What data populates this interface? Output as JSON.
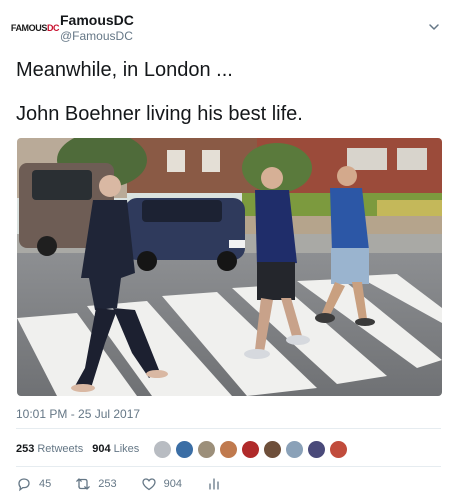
{
  "account": {
    "display_name": "FamousDC",
    "handle": "@FamousDC",
    "logo_text_left": "FAMOUS",
    "logo_text_right": "DC"
  },
  "tweet": {
    "line1": "Meanwhile, in London ...",
    "line2": "John Boehner living his best life."
  },
  "media": {
    "icon": "photo"
  },
  "timestamp": "10:01 PM - 25 Jul 2017",
  "stats": {
    "retweets_count": "253",
    "retweets_label": "Retweets",
    "likes_count": "904",
    "likes_label": "Likes"
  },
  "likers": [
    {
      "color": "#b8bcc2"
    },
    {
      "color": "#3b6ea5"
    },
    {
      "color": "#9c8f7a"
    },
    {
      "color": "#c07a4e"
    },
    {
      "color": "#b02a2a"
    },
    {
      "color": "#6e4f3a"
    },
    {
      "color": "#8aa1b8"
    },
    {
      "color": "#4a4a7a"
    },
    {
      "color": "#c14c3c"
    }
  ],
  "actions": {
    "reply_count": "45",
    "retweet_count": "253",
    "like_count": "904"
  }
}
